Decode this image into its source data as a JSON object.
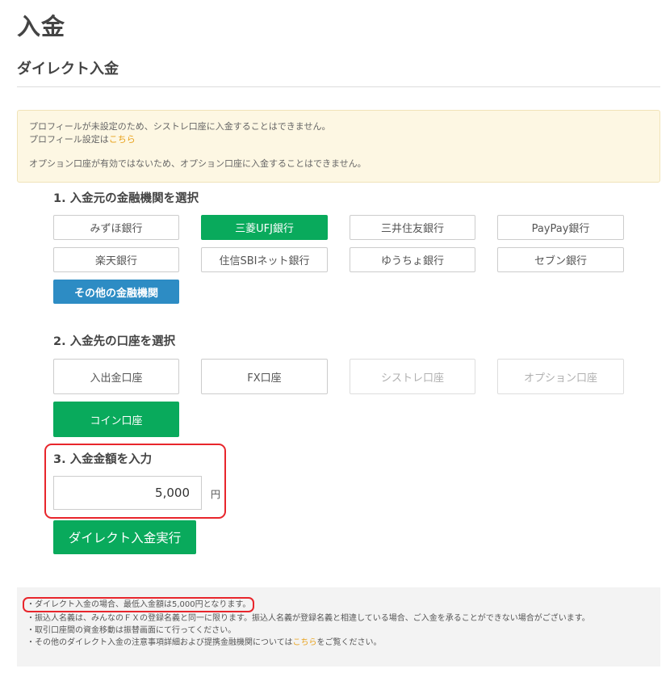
{
  "page_title": "入金",
  "section_title": "ダイレクト入金",
  "notice": {
    "line1": "プロフィールが未設定のため、シストレ口座に入金することはできません。",
    "line2_prefix": "プロフィール設定は",
    "line2_link": "こちら",
    "line3": "オプション口座が有効ではないため、オプション口座に入金することはできません。"
  },
  "step1": {
    "title": "1. 入金元の金融機関を選択",
    "banks": [
      "みずほ銀行",
      "三菱UFJ銀行",
      "三井住友銀行",
      "PayPay銀行",
      "楽天銀行",
      "住信SBIネット銀行",
      "ゆうちょ銀行",
      "セブン銀行"
    ],
    "other": "その他の金融機関",
    "selected": "三菱UFJ銀行"
  },
  "step2": {
    "title": "2. 入金先の口座を選択",
    "accounts": [
      "入出金口座",
      "FX口座",
      "シストレ口座",
      "オプション口座",
      "コイン口座"
    ],
    "selected": "コイン口座",
    "disabled": [
      "シストレ口座",
      "オプション口座"
    ]
  },
  "step3": {
    "title": "3. 入金金額を入力",
    "amount": "5,000",
    "unit": "円"
  },
  "execute_label": "ダイレクト入金実行",
  "notes": {
    "line1": "・ダイレクト入金の場合、最低入金額は5,000円となります。",
    "line2": "・振込人名義は、みんなのＦＸの登録名義と同一に限ります。振込人名義が登録名義と相違している場合、ご入金を承ることができない場合がございます。",
    "line3": "・取引口座間の資金移動は振替画面にて行ってください。",
    "line4_prefix": "・その他のダイレクト入金の注意事項詳細および提携金融機関については",
    "line4_link": "こちら",
    "line4_suffix": "をご覧ください。"
  },
  "colors": {
    "accent_green": "#09aa5c",
    "accent_blue": "#2d8cc4",
    "link_orange": "#e8a21c",
    "highlight_red": "#e8262c"
  }
}
